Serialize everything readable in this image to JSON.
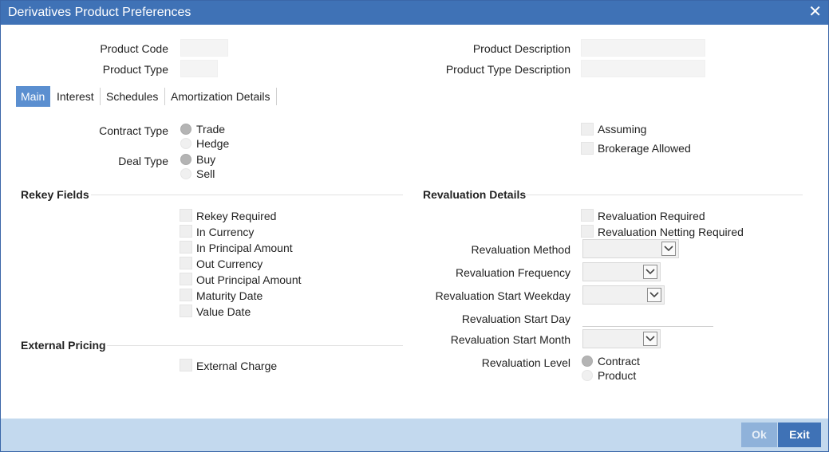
{
  "window": {
    "title": "Derivatives Product Preferences",
    "close_glyph": "✕"
  },
  "header": {
    "product_code_label": "Product Code",
    "product_type_label": "Product Type",
    "product_description_label": "Product Description",
    "product_type_description_label": "Product Type Description",
    "product_code_value": "",
    "product_type_value": "",
    "product_description_value": "",
    "product_type_description_value": ""
  },
  "tabs": [
    "Main",
    "Interest",
    "Schedules",
    "Amortization Details"
  ],
  "main": {
    "contract_type_label": "Contract Type",
    "contract_type_options": [
      "Trade",
      "Hedge"
    ],
    "contract_type_selected": "Trade",
    "deal_type_label": "Deal Type",
    "deal_type_options": [
      "Buy",
      "Sell"
    ],
    "deal_type_selected": "Buy",
    "assuming_label": "Assuming",
    "brokerage_allowed_label": "Brokerage Allowed"
  },
  "rekey": {
    "heading": "Rekey Fields",
    "items": [
      "Rekey Required",
      "In Currency",
      "In Principal Amount",
      "Out Currency",
      "Out Principal Amount",
      "Maturity Date",
      "Value Date"
    ]
  },
  "external_pricing": {
    "heading": "External Pricing",
    "external_charge_label": "External Charge"
  },
  "revaluation": {
    "heading": "Revaluation Details",
    "required_label": "Revaluation Required",
    "netting_required_label": "Revaluation Netting Required",
    "method_label": "Revaluation Method",
    "frequency_label": "Revaluation Frequency",
    "start_weekday_label": "Revaluation Start Weekday",
    "start_day_label": "Revaluation Start Day",
    "start_month_label": "Revaluation Start Month",
    "level_label": "Revaluation Level",
    "level_options": [
      "Contract",
      "Product"
    ],
    "level_selected": "Contract",
    "method_value": "",
    "frequency_value": "",
    "start_weekday_value": "",
    "start_day_value": "",
    "start_month_value": ""
  },
  "footer": {
    "ok_label": "Ok",
    "exit_label": "Exit"
  },
  "colors": {
    "titlebar": "#3f72b6",
    "active_tab": "#5b8fd0",
    "footer": "#c3d9ee"
  }
}
